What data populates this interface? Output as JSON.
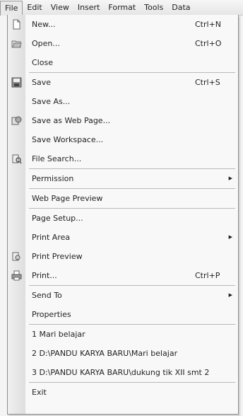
{
  "menubar": {
    "items": [
      "File",
      "Edit",
      "View",
      "Insert",
      "Format",
      "Tools",
      "Data"
    ]
  },
  "file_menu": {
    "new": {
      "label": "New...",
      "shortcut": "Ctrl+N"
    },
    "open": {
      "label": "Open...",
      "shortcut": "Ctrl+O"
    },
    "close": {
      "label": "Close"
    },
    "save": {
      "label": "Save",
      "shortcut": "Ctrl+S"
    },
    "save_as": {
      "label": "Save As..."
    },
    "save_as_web": {
      "label": "Save as Web Page..."
    },
    "save_workspace": {
      "label": "Save Workspace..."
    },
    "file_search": {
      "label": "File Search..."
    },
    "permission": {
      "label": "Permission"
    },
    "web_page_preview": {
      "label": "Web Page Preview"
    },
    "page_setup": {
      "label": "Page Setup..."
    },
    "print_area": {
      "label": "Print Area"
    },
    "print_preview": {
      "label": "Print Preview"
    },
    "print": {
      "label": "Print...",
      "shortcut": "Ctrl+P"
    },
    "send_to": {
      "label": "Send To"
    },
    "properties": {
      "label": "Properties"
    },
    "recent_1": {
      "label": "1 Mari belajar"
    },
    "recent_2": {
      "label": "2 D:\\PANDU KARYA BARU\\Mari belajar"
    },
    "recent_3": {
      "label": "3 D:\\PANDU KARYA BARU\\dukung tik XII smt 2"
    },
    "exit": {
      "label": "Exit"
    },
    "submenu_arrow": "▶"
  }
}
